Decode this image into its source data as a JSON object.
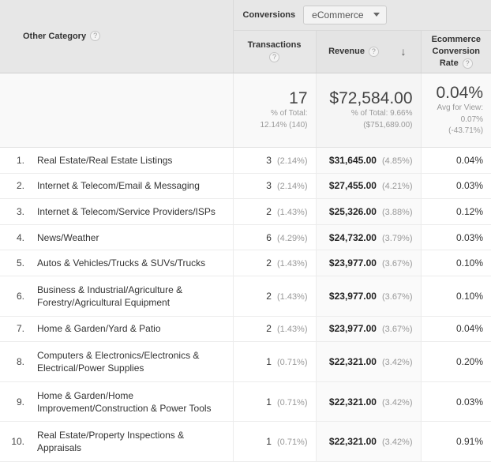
{
  "conversions": {
    "label": "Conversions",
    "selected": "eCommerce",
    "caret_icon": "chevron-down-icon"
  },
  "columns": {
    "dimension": "Other Category",
    "transactions": "Transactions",
    "revenue": "Revenue",
    "ecr_line1": "Ecommerce",
    "ecr_line2": "Conversion",
    "ecr_line3": "Rate",
    "help_icon": "?",
    "sort_arrow_icon": "↓"
  },
  "summary": {
    "transactions": {
      "value": "17",
      "sub1": "% of Total:",
      "sub2": "12.14% (140)"
    },
    "revenue": {
      "value": "$72,584.00",
      "sub1": "% of Total: 9.66%",
      "sub2": "($751,689.00)"
    },
    "ecr": {
      "value": "0.04%",
      "sub1": "Avg for View:",
      "sub2": "0.07%",
      "sub3": "(-43.71%)"
    }
  },
  "rows": [
    {
      "index": "1.",
      "category": "Real Estate/Real Estate Listings",
      "transactions": "3",
      "transactions_pct": "(2.14%)",
      "revenue": "$31,645.00",
      "revenue_pct": "(4.85%)",
      "ecr": "0.04%"
    },
    {
      "index": "2.",
      "category": "Internet & Telecom/Email & Messaging",
      "transactions": "3",
      "transactions_pct": "(2.14%)",
      "revenue": "$27,455.00",
      "revenue_pct": "(4.21%)",
      "ecr": "0.03%"
    },
    {
      "index": "3.",
      "category": "Internet & Telecom/Service Providers/ISPs",
      "transactions": "2",
      "transactions_pct": "(1.43%)",
      "revenue": "$25,326.00",
      "revenue_pct": "(3.88%)",
      "ecr": "0.12%"
    },
    {
      "index": "4.",
      "category": "News/Weather",
      "transactions": "6",
      "transactions_pct": "(4.29%)",
      "revenue": "$24,732.00",
      "revenue_pct": "(3.79%)",
      "ecr": "0.03%"
    },
    {
      "index": "5.",
      "category": "Autos & Vehicles/Trucks & SUVs/Trucks",
      "transactions": "2",
      "transactions_pct": "(1.43%)",
      "revenue": "$23,977.00",
      "revenue_pct": "(3.67%)",
      "ecr": "0.10%"
    },
    {
      "index": "6.",
      "category": "Business & Industrial/Agriculture & Forestry/Agricultural Equipment",
      "transactions": "2",
      "transactions_pct": "(1.43%)",
      "revenue": "$23,977.00",
      "revenue_pct": "(3.67%)",
      "ecr": "0.10%"
    },
    {
      "index": "7.",
      "category": "Home & Garden/Yard & Patio",
      "transactions": "2",
      "transactions_pct": "(1.43%)",
      "revenue": "$23,977.00",
      "revenue_pct": "(3.67%)",
      "ecr": "0.04%"
    },
    {
      "index": "8.",
      "category": "Computers & Electronics/Electronics & Electrical/Power Supplies",
      "transactions": "1",
      "transactions_pct": "(0.71%)",
      "revenue": "$22,321.00",
      "revenue_pct": "(3.42%)",
      "ecr": "0.20%"
    },
    {
      "index": "9.",
      "category": "Home & Garden/Home Improvement/Construction & Power Tools",
      "transactions": "1",
      "transactions_pct": "(0.71%)",
      "revenue": "$22,321.00",
      "revenue_pct": "(3.42%)",
      "ecr": "0.03%"
    },
    {
      "index": "10.",
      "category": "Real Estate/Property Inspections & Appraisals",
      "transactions": "1",
      "transactions_pct": "(0.71%)",
      "revenue": "$22,321.00",
      "revenue_pct": "(3.42%)",
      "ecr": "0.91%"
    }
  ],
  "colors": {
    "header_bg": "#e7e7e7",
    "summary_bg": "#f9f9f9",
    "sorted_col_bg": "#fafafa",
    "text": "#333333",
    "muted": "#999999"
  }
}
